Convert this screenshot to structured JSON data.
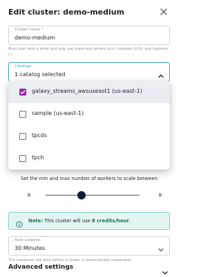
{
  "header": {
    "title": "Edit cluster: demo-medium"
  },
  "cluster_name": {
    "label": "Cluster name *",
    "value": "demo-medium",
    "hint": "Must start with a letter and only use lowercase letters (a-z), numbers (0-9), and hyphens (-)"
  },
  "catalogs": {
    "label": "Catalogs",
    "value": "1 catalog selected",
    "options": [
      {
        "label": "galaxy_streams_awsuseast1 (us-east-1)",
        "checked": true
      },
      {
        "label": "sample (us-east-1)",
        "checked": false
      },
      {
        "label": "tpcds",
        "checked": false
      },
      {
        "label": "tpch",
        "checked": false
      }
    ]
  },
  "scaling": {
    "text": "Set the min and max number of workers to scale between:",
    "min": "8",
    "max": "8"
  },
  "note": {
    "prefix": "Note:",
    "text": " This cluster will use ",
    "credits": "8 credits/hour",
    "suffix": "."
  },
  "auto_suspend": {
    "label": "Auto suspend",
    "value": "30 Minutes",
    "hint": "The maximum idle time before a cluster is automatically suspended."
  },
  "advanced": {
    "label": "Advanced settings"
  },
  "colors": {
    "accent": "#38a3b5",
    "checkbox": "#9c2aa8",
    "note_bg": "#e3f5f2",
    "slider_thumb": "#0f1a36"
  },
  "icons": [
    "close-icon",
    "chevron-up-icon",
    "check-icon",
    "info-icon",
    "chevron-down-icon"
  ]
}
